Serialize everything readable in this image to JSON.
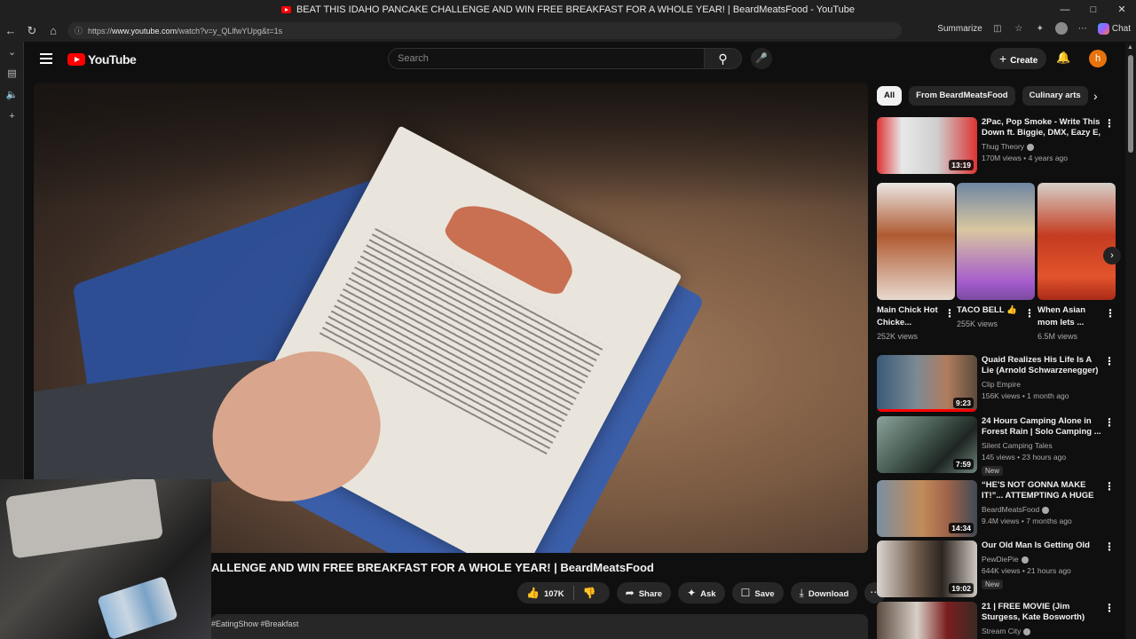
{
  "browser": {
    "window_title": "BEAT THIS IDAHO PANCAKE CHALLENGE AND WIN FREE BREAKFAST FOR A WHOLE YEAR! | BeardMeatsFood - YouTube",
    "url_prefix": "https://",
    "url_host": "www.youtube.com",
    "url_path": "/watch?v=y_QLlfwYUpg&t=1s",
    "summarize_label": "Summarize",
    "chat_label": "Chat",
    "minimize": "—",
    "maximize": "□",
    "close": "✕"
  },
  "youtube": {
    "logo_text": "YouTube",
    "search_placeholder": "Search",
    "create_label": "Create",
    "avatar_letter": "h"
  },
  "video": {
    "title_visible": "ALLENGE AND WIN FREE BREAKFAST FOR A WHOLE YEAR! | BeardMeatsFood",
    "likes": "107K",
    "share_label": "Share",
    "ask_label": "Ask",
    "save_label": "Save",
    "download_label": "Download",
    "description_tags": "#EatingShow #Breakfast"
  },
  "chips": [
    {
      "label": "All",
      "active": true
    },
    {
      "label": "From BeardMeatsFood",
      "active": false
    },
    {
      "label": "Culinary arts",
      "active": false
    }
  ],
  "recommendations": [
    {
      "title": "2Pac, Pop Smoke - Write This Down ft. Biggie, DMX, Eazy E, ...",
      "channel": "Thug Theory",
      "meta": "170M views • 4 years ago",
      "duration": "13:19",
      "badge": ""
    },
    {
      "title": "Quaid Realizes His Life Is A Lie (Arnold Schwarzenegger) | Tot...",
      "channel": "Clip Empire",
      "meta": "156K views • 1 month ago",
      "duration": "9:23",
      "badge": ""
    },
    {
      "title": "24 Hours Camping Alone in Forest Rain | Solo Camping ...",
      "channel": "Silent Camping Tales",
      "meta": "145 views • 23 hours ago",
      "duration": "7:59",
      "badge": "New"
    },
    {
      "title": "“HE'S NOT GONNA MAKE IT!”... ATTEMPTING A HUGE ...",
      "channel": "BeardMeatsFood",
      "meta": "9.4M views • 7 months ago",
      "duration": "14:34",
      "badge": ""
    },
    {
      "title": "Our Old Man Is Getting Old",
      "channel": "PewDiePie",
      "meta": "644K views • 21 hours ago",
      "duration": "19:02",
      "badge": "New"
    },
    {
      "title": "21 | FREE MOVIE (Jim Sturgess, Kate Bosworth)",
      "channel": "Stream City",
      "meta": "",
      "duration": "",
      "badge": ""
    }
  ],
  "shorts": [
    {
      "title": "Main Chick Hot Chicke...",
      "views": "252K views"
    },
    {
      "title": "TACO BELL 👍",
      "views": "255K views"
    },
    {
      "title": "When Asian mom lets ...",
      "views": "6.5M views"
    }
  ],
  "colors": {
    "yt_red": "#ff0000",
    "background": "#0f0f0f",
    "avatar": "#e8720c"
  }
}
